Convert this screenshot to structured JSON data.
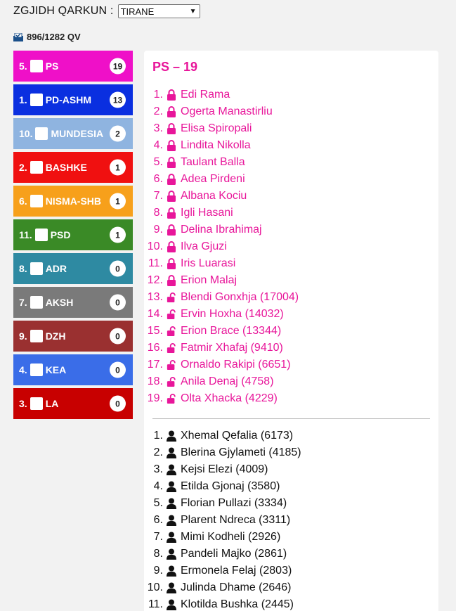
{
  "header": {
    "label": "ZGJIDH QARKUN :",
    "selected_region": "TIRANE"
  },
  "counter": {
    "text": "896/1282 QV",
    "icon": "ballot-box-icon"
  },
  "parties": [
    {
      "id": "ps",
      "label": "5.",
      "name": "PS",
      "seats": "19",
      "color": "#ef10c8"
    },
    {
      "id": "pd-ashm",
      "label": "1.",
      "name": "PD-ASHM",
      "seats": "13",
      "color": "#0a2fe0"
    },
    {
      "id": "mundesia",
      "label": "10.",
      "name": "MUNDESIA",
      "seats": "2",
      "color": "#8fb4e0"
    },
    {
      "id": "bashke",
      "label": "2.",
      "name": "BASHKE",
      "seats": "1",
      "color": "#f01010"
    },
    {
      "id": "nisma-shb",
      "label": "6.",
      "name": "NISMA-SHB",
      "seats": "1",
      "color": "#f7a01b"
    },
    {
      "id": "psd",
      "label": "11.",
      "name": "PSD",
      "seats": "1",
      "color": "#3a8a26"
    },
    {
      "id": "adr",
      "label": "8.",
      "name": "ADR",
      "seats": "0",
      "color": "#2e8aa2"
    },
    {
      "id": "aksh",
      "label": "7.",
      "name": "AKSH",
      "seats": "0",
      "color": "#7a7a7a"
    },
    {
      "id": "dzh",
      "label": "9.",
      "name": "DZH",
      "seats": "0",
      "color": "#9a3030"
    },
    {
      "id": "kea",
      "label": "4.",
      "name": "KEA",
      "seats": "0",
      "color": "#3a6de8"
    },
    {
      "id": "la",
      "label": "3.",
      "name": "LA",
      "seats": "0",
      "color": "#c80000"
    }
  ],
  "panel": {
    "title": "PS – 19",
    "elected": [
      {
        "n": "1.",
        "name": "Edi Rama",
        "locked": true
      },
      {
        "n": "2.",
        "name": "Ogerta Manastirliu",
        "locked": true
      },
      {
        "n": "3.",
        "name": "Elisa Spiropali",
        "locked": true
      },
      {
        "n": "4.",
        "name": "Lindita Nikolla",
        "locked": true
      },
      {
        "n": "5.",
        "name": "Taulant Balla",
        "locked": true
      },
      {
        "n": "6.",
        "name": "Adea Pirdeni",
        "locked": true
      },
      {
        "n": "7.",
        "name": "Albana Kociu",
        "locked": true
      },
      {
        "n": "8.",
        "name": "Igli Hasani",
        "locked": true
      },
      {
        "n": "9.",
        "name": "Delina Ibrahimaj",
        "locked": true
      },
      {
        "n": "10.",
        "name": "Ilva Gjuzi",
        "locked": true
      },
      {
        "n": "11.",
        "name": "Iris Luarasi",
        "locked": true
      },
      {
        "n": "12.",
        "name": "Erion Malaj",
        "locked": true
      },
      {
        "n": "13.",
        "name": "Blendi Gonxhja (17004)",
        "locked": false
      },
      {
        "n": "14.",
        "name": "Ervin Hoxha (14032)",
        "locked": false
      },
      {
        "n": "15.",
        "name": "Erion Brace (13344)",
        "locked": false
      },
      {
        "n": "16.",
        "name": "Fatmir Xhafaj (9410)",
        "locked": false
      },
      {
        "n": "17.",
        "name": "Ornaldo Rakipi (6651)",
        "locked": false
      },
      {
        "n": "18.",
        "name": "Anila Denaj (4758)",
        "locked": false
      },
      {
        "n": "19.",
        "name": "Olta Xhacka (4229)",
        "locked": false
      }
    ],
    "others": [
      {
        "n": "1.",
        "name": "Xhemal Qefalia (6173)"
      },
      {
        "n": "2.",
        "name": "Blerina Gjylameti (4185)"
      },
      {
        "n": "3.",
        "name": "Kejsi Elezi (4009)"
      },
      {
        "n": "4.",
        "name": "Etilda Gjonaj (3580)"
      },
      {
        "n": "5.",
        "name": "Florian Pullazi (3334)"
      },
      {
        "n": "6.",
        "name": "Plarent Ndreca (3311)"
      },
      {
        "n": "7.",
        "name": "Mimi Kodheli (2926)"
      },
      {
        "n": "8.",
        "name": "Pandeli Majko (2861)"
      },
      {
        "n": "9.",
        "name": "Ermonela Felaj (2803)"
      },
      {
        "n": "10.",
        "name": "Julinda Dhame (2646)"
      },
      {
        "n": "11.",
        "name": "Klotilda Bushka (2445)"
      }
    ]
  }
}
